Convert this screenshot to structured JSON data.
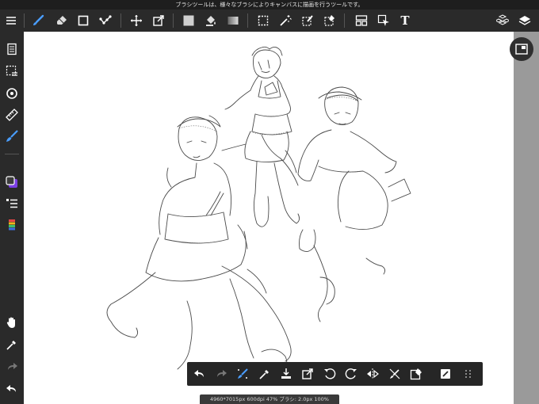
{
  "hint_text": "ブラシツールは、様々なブラシによりキャンバスに描画を行うツールです。",
  "status_text": "4960*7015px 600dpi 47% ブラシ: 2.0px 100%",
  "colors": {
    "accent": "#4a9eff",
    "toolbar_bg": "#2a2a2a",
    "canvas_bg": "#ffffff",
    "side_panel": "#9a9a9a",
    "current_color": "#7b3fe4"
  },
  "toolbar": {
    "active_tool": "brush-tool",
    "text_tool_label": "T",
    "tools": [
      "menu-icon",
      "brush-tool",
      "eraser-tool",
      "shape-tool",
      "dot-tool",
      "move-tool",
      "transform-tool",
      "fill-color-swatch",
      "fill-tool",
      "gradient-tool",
      "select-tool",
      "magic-wand-tool",
      "select-pen-tool",
      "select-eraser-tool",
      "frame-divider-tool",
      "select-object-tool",
      "text-tool",
      "3d-material-icon",
      "layers-icon"
    ]
  },
  "left_tools": [
    "layer-list-icon",
    "selection-icon",
    "rotate-view-icon",
    "ruler-icon",
    "snap-brush-icon",
    "color-icon",
    "brush-list-icon",
    "palette-icon",
    "hand-icon",
    "eyedropper-icon",
    "redo-icon",
    "undo-icon"
  ],
  "quick_tools": [
    "undo-icon",
    "redo-icon",
    "brush-size-icon",
    "eyedropper-icon",
    "save-icon",
    "transform-icon",
    "rotate-left-icon",
    "rotate-right-icon",
    "flip-icon",
    "snap-off-icon",
    "clear-icon",
    "screen-icon",
    "more-icon"
  ]
}
